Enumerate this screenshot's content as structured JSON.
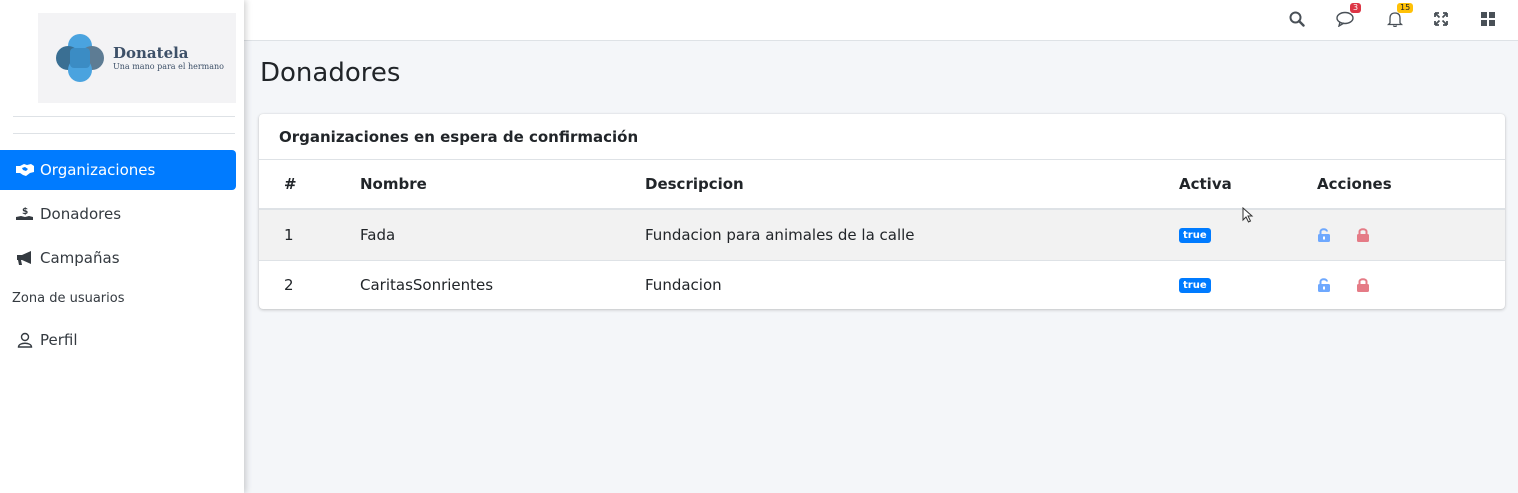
{
  "brand": {
    "name": "Donatela",
    "tagline": "Una mano para el hermano"
  },
  "sidebar": {
    "items": [
      {
        "label": "Organizaciones",
        "icon": "handshake-icon",
        "active": true
      },
      {
        "label": "Donadores",
        "icon": "hand-holding-dollar-icon",
        "active": false
      },
      {
        "label": "Campañas",
        "icon": "bullhorn-icon",
        "active": false
      }
    ],
    "section_header": "Zona de usuarios",
    "user_items": [
      {
        "label": "Perfil",
        "icon": "user-icon"
      }
    ]
  },
  "topbar": {
    "messages_count": "3",
    "notifications_count": "15",
    "icons": [
      "search-icon",
      "messages-icon",
      "bell-icon",
      "fullscreen-icon",
      "grid-icon"
    ]
  },
  "page": {
    "title": "Donadores"
  },
  "card": {
    "title": "Organizaciones en espera de confirmación",
    "columns": [
      "#",
      "Nombre",
      "Descripcion",
      "Activa",
      "Acciones"
    ],
    "rows": [
      {
        "num": "1",
        "nombre": "Fada",
        "descripcion": "Fundacion para animales de la calle",
        "activa": "true"
      },
      {
        "num": "2",
        "nombre": "CaritasSonrientes",
        "descripcion": "Fundacion",
        "activa": "true"
      }
    ]
  },
  "colors": {
    "primary": "#007bff",
    "unlock": "#6ea8fe",
    "lock": "#e57b86",
    "badge_danger": "#dc3545",
    "badge_warning": "#ffc107"
  }
}
